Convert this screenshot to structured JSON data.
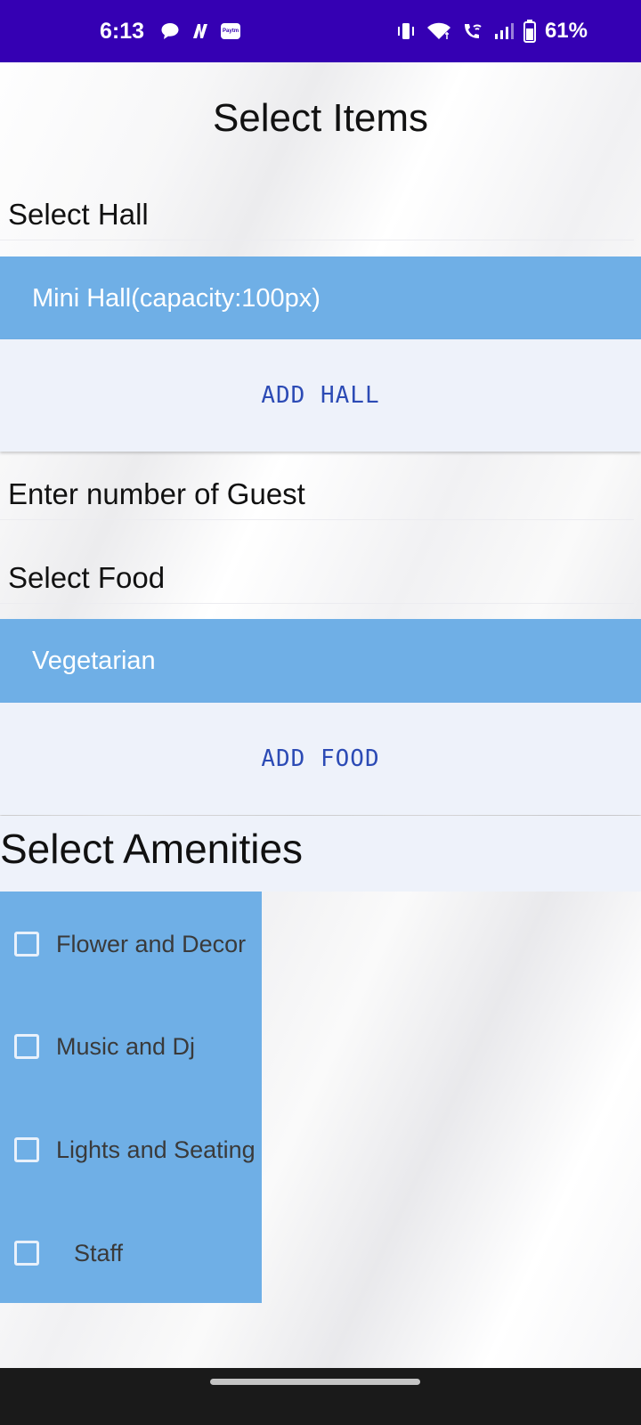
{
  "status_bar": {
    "time": "6:13",
    "battery": "61%",
    "paytm_text": "Paytm",
    "left_icons": [
      "chat-bubble-icon",
      "n-logo-icon",
      "paytm-icon"
    ],
    "right_icons": [
      "vibrate-icon",
      "wifi-icon",
      "wifi-calling-icon",
      "signal-icon",
      "battery-icon"
    ],
    "background": "#3500b3"
  },
  "page": {
    "title": "Select Items"
  },
  "hall": {
    "label": "Select Hall",
    "selected": "Mini Hall(capacity:100px)",
    "add_button": "ADD HALL"
  },
  "guests": {
    "placeholder": "Enter number of Guest"
  },
  "food": {
    "label": "Select Food",
    "selected": "Vegetarian",
    "add_button": "ADD FOOD"
  },
  "amenities": {
    "title": "Select Amenities",
    "items": [
      {
        "label": "Flower and Decor",
        "checked": false
      },
      {
        "label": "Music and Dj",
        "checked": false
      },
      {
        "label": "Lights and Seating",
        "checked": false
      },
      {
        "label": "Staff",
        "checked": false
      }
    ]
  },
  "colors": {
    "accent_blue": "#6fafe6",
    "button_bg": "#eef2fa",
    "button_text": "#2c4bb5"
  }
}
